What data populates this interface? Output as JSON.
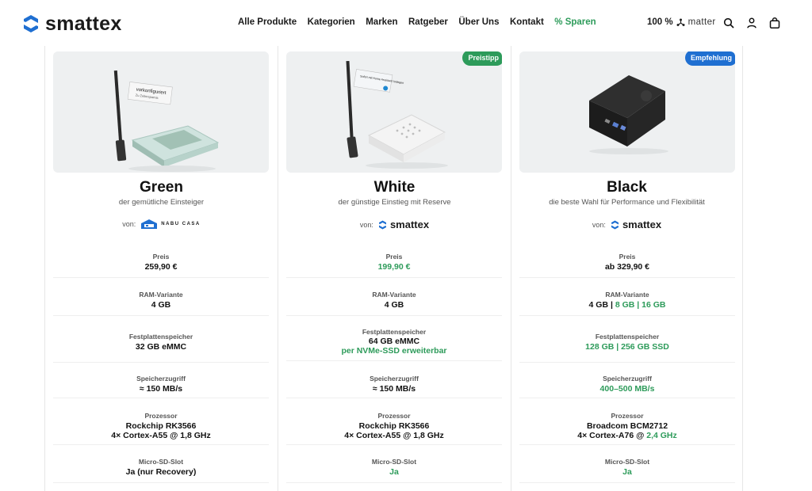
{
  "header": {
    "brand": "smattex",
    "nav": [
      "Alle Produkte",
      "Kategorien",
      "Marken",
      "Ratgeber",
      "Über Uns",
      "Kontakt",
      "% Sparen"
    ],
    "matter_prefix": "100 %",
    "matter_word": "matter",
    "icons": [
      "search-icon",
      "account-icon",
      "cart-icon"
    ]
  },
  "colors": {
    "accent_green": "#2d9b5a",
    "badge_blue": "#1f6fd1",
    "image_bg": "#eef0f1"
  },
  "cards": [
    {
      "badge": "",
      "title": "Green",
      "subtitle": "der gemütliche Einsteiger",
      "von": "von:",
      "brand": "NABU CASA",
      "image_label": "vorkonfiguriert",
      "image_label_sub": "Zu Zeitersparnis",
      "specs": [
        {
          "label": "Preis",
          "value": "259,90 €",
          "value_green": ""
        },
        {
          "label": "RAM-Variante",
          "value": "4 GB",
          "value_green": ""
        },
        {
          "label": "Festplattenspeicher",
          "value": "32 GB eMMC",
          "value_green": ""
        },
        {
          "label": "Speicherzugriff",
          "value": "≈ 150 MB/s",
          "value_green": ""
        },
        {
          "label": "Prozessor",
          "value": "Rockchip RK3566",
          "value2": "4× Cortex-A55 @ 1,8 GHz"
        },
        {
          "label": "Micro-SD-Slot",
          "value": "Ja (nur Recovery)",
          "value_green": ""
        }
      ]
    },
    {
      "badge": "Preistipp",
      "title": "White",
      "subtitle": "der günstige Einstieg mit Reserve",
      "von": "von:",
      "brand": "smattex",
      "image_label": "Sofort mit Home Assistant loslegen",
      "specs": [
        {
          "label": "Preis",
          "value": "",
          "value_green": "199,90 €"
        },
        {
          "label": "RAM-Variante",
          "value": "4 GB",
          "value_green": ""
        },
        {
          "label": "Festplattenspeicher",
          "value": "64 GB eMMC",
          "value_green": "per NVMe-SSD erweiterbar"
        },
        {
          "label": "Speicherzugriff",
          "value": "≈ 150 MB/s",
          "value_green": ""
        },
        {
          "label": "Prozessor",
          "value": "Rockchip RK3566",
          "value2": "4× Cortex-A55 @ 1,8 GHz"
        },
        {
          "label": "Micro-SD-Slot",
          "value": "",
          "value_green": "Ja"
        }
      ]
    },
    {
      "badge": "Empfehlung",
      "title": "Black",
      "subtitle": "die beste Wahl für Performance und Flexibilität",
      "von": "von:",
      "brand": "smattex",
      "specs": [
        {
          "label": "Preis",
          "value": "ab 329,90 €",
          "value_green": ""
        },
        {
          "label": "RAM-Variante",
          "value": "4 GB |",
          "value_green": "8 GB | 16 GB"
        },
        {
          "label": "Festplattenspeicher",
          "value": "",
          "value_green": "128 GB | 256 GB SSD"
        },
        {
          "label": "Speicherzugriff",
          "value": "",
          "value_green": "400–500 MB/s"
        },
        {
          "label": "Prozessor",
          "value": "Broadcom BCM2712",
          "value2": "4× Cortex-A76 @",
          "value2_green": "2,4 GHz"
        },
        {
          "label": "Micro-SD-Slot",
          "value": "",
          "value_green": "Ja"
        }
      ]
    }
  ]
}
